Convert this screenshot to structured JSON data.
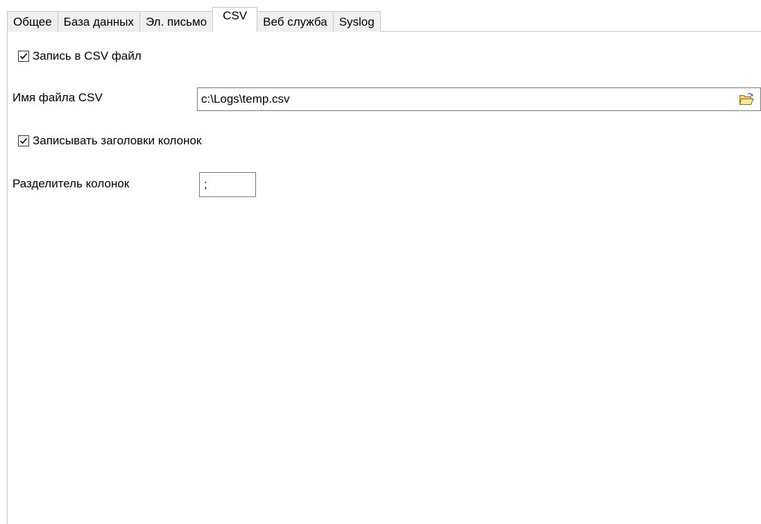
{
  "tabs": [
    {
      "label": "Общее"
    },
    {
      "label": "База данных"
    },
    {
      "label": "Эл. письмо"
    },
    {
      "label": "CSV",
      "active": true
    },
    {
      "label": "Веб служба"
    },
    {
      "label": "Syslog"
    }
  ],
  "csv": {
    "write_csv": {
      "label": "Запись в CSV файл",
      "checked": true
    },
    "file_name": {
      "label": "Имя файла CSV",
      "value": "c:\\Logs\\temp.csv",
      "browse_icon": "folder-open-icon"
    },
    "write_headers": {
      "label": "Записывать заголовки колонок",
      "checked": true
    },
    "separator": {
      "label": "Разделитель колонок",
      "value": ";"
    }
  },
  "colors": {
    "accent_folder": "#e8c14a",
    "border": "#7a7a7a",
    "tab_bg": "#f0f0f0"
  }
}
